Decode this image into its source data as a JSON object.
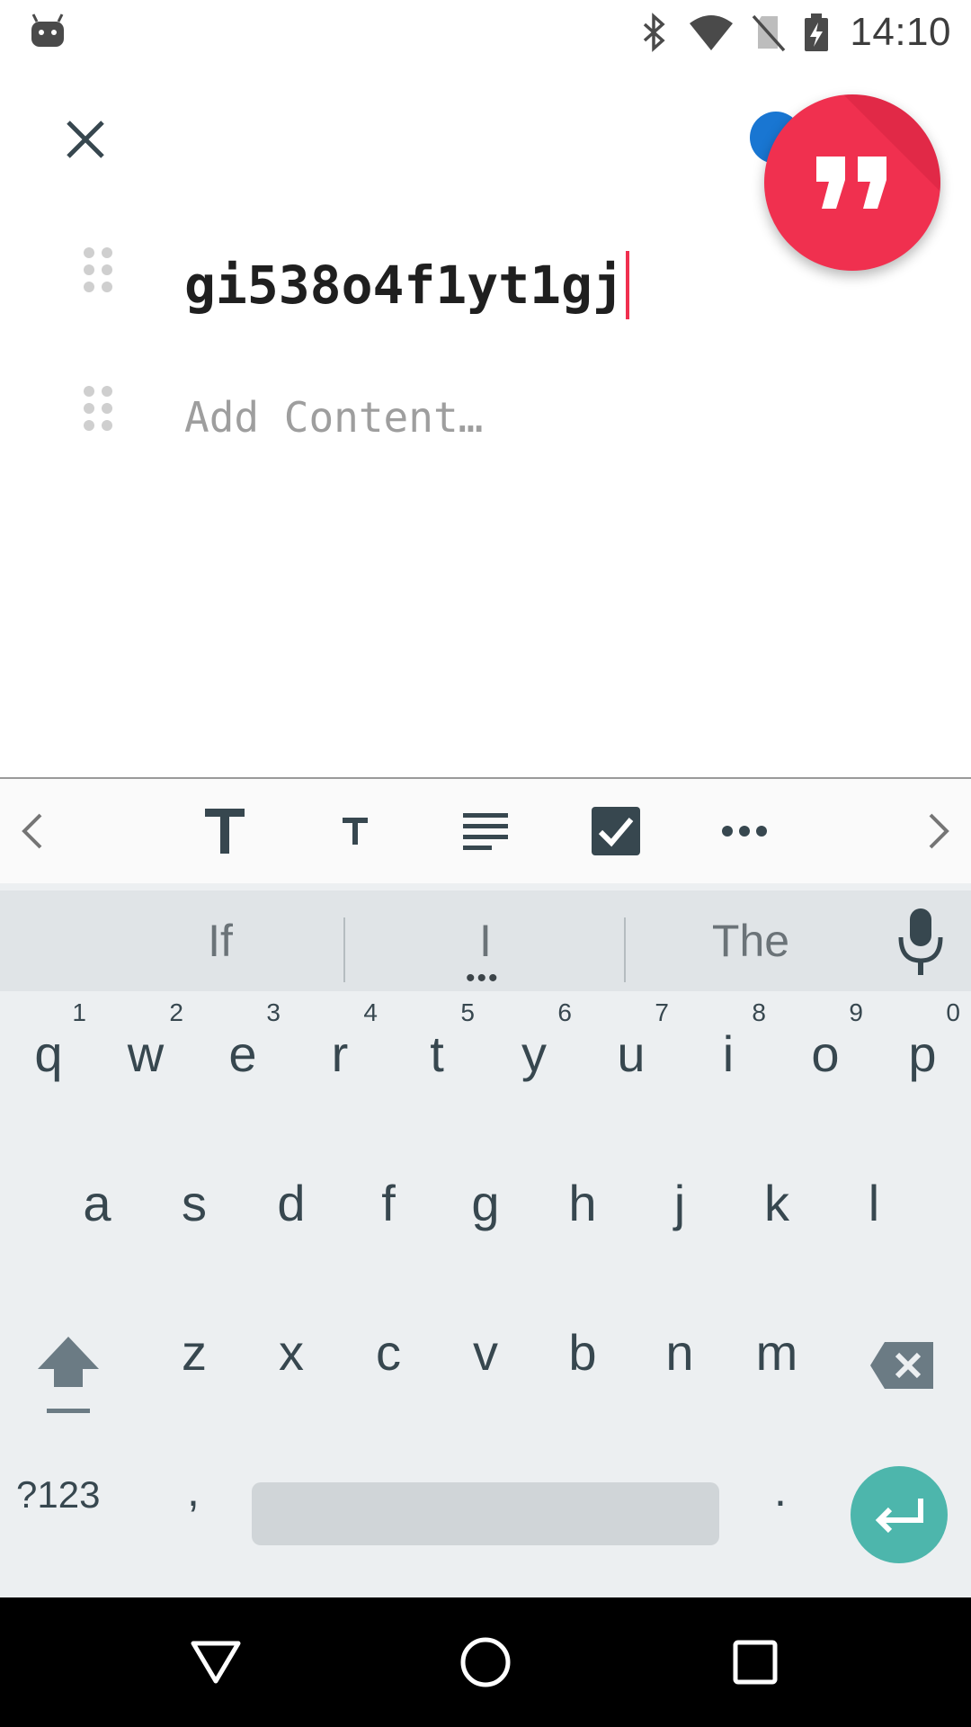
{
  "status_bar": {
    "time": "14:10",
    "icons": [
      "android-debug-icon",
      "bluetooth-icon",
      "wifi-icon",
      "no-sim-icon",
      "battery-charging-icon"
    ]
  },
  "editor": {
    "close_icon": "close-icon",
    "quote_icon": "format-quote-icon",
    "title_value": "gi538o4f1yt1gj",
    "content_placeholder": "Add Content…",
    "colors": {
      "accent": "#f0304f",
      "fab_blue": "#1976d2",
      "caret": "#f0304f"
    }
  },
  "toolbar": {
    "items": [
      "chevron-left-icon",
      "title-format-icon",
      "heading-format-icon",
      "paragraph-format-icon",
      "checklist-icon",
      "more-icon",
      "chevron-right-icon"
    ]
  },
  "keyboard": {
    "suggestions": [
      "If",
      "I",
      "The"
    ],
    "suggestion_more": "•••",
    "row1": [
      {
        "key": "q",
        "hint": "1"
      },
      {
        "key": "w",
        "hint": "2"
      },
      {
        "key": "e",
        "hint": "3"
      },
      {
        "key": "r",
        "hint": "4"
      },
      {
        "key": "t",
        "hint": "5"
      },
      {
        "key": "y",
        "hint": "6"
      },
      {
        "key": "u",
        "hint": "7"
      },
      {
        "key": "i",
        "hint": "8"
      },
      {
        "key": "o",
        "hint": "9"
      },
      {
        "key": "p",
        "hint": "0"
      }
    ],
    "row2": [
      "a",
      "s",
      "d",
      "f",
      "g",
      "h",
      "j",
      "k",
      "l"
    ],
    "row3": [
      "z",
      "x",
      "c",
      "v",
      "b",
      "n",
      "m"
    ],
    "symbols_label": "?123",
    "comma_label": ",",
    "period_label": ".",
    "enter_color": "#4db6ac"
  },
  "nav_bar": {
    "items": [
      "back-icon",
      "home-icon",
      "recents-icon"
    ]
  }
}
